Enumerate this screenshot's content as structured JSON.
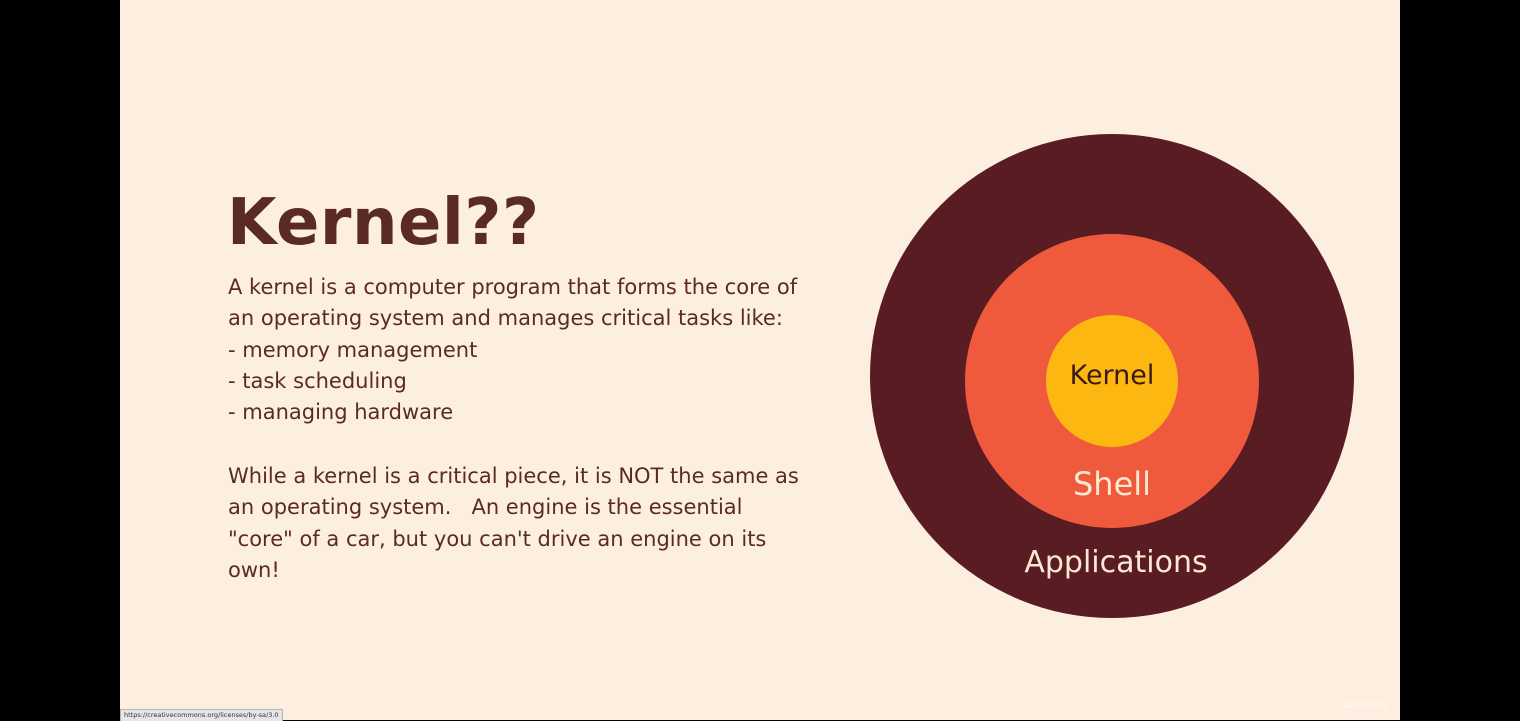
{
  "slide": {
    "title": "Kernel??",
    "paragraph1": [
      "A kernel is a computer program that forms the core of",
      "an operating system and manages critical tasks like:",
      "- memory management",
      "- task scheduling",
      "- managing hardware"
    ],
    "paragraph2": [
      "While a kernel is a critical piece, it is NOT the same as",
      "an operating system.   An engine is the essential",
      "\"core\" of a car, but you can't drive an engine on its",
      "own!"
    ]
  },
  "diagram": {
    "layers": {
      "outer": "Applications",
      "middle": "Shell",
      "inner": "Kernel"
    },
    "colors": {
      "outer": "#5a1c23",
      "middle": "#f05a3c",
      "inner": "#fcb810"
    }
  },
  "status_bar": {
    "link_url": "https://creativecommons.org/licenses/by-sa/3.0"
  },
  "watermark": {
    "text": "Udemy"
  },
  "colors": {
    "slide_background": "#fdefdf",
    "text": "#5a2a24",
    "letterbox": "#000000"
  }
}
